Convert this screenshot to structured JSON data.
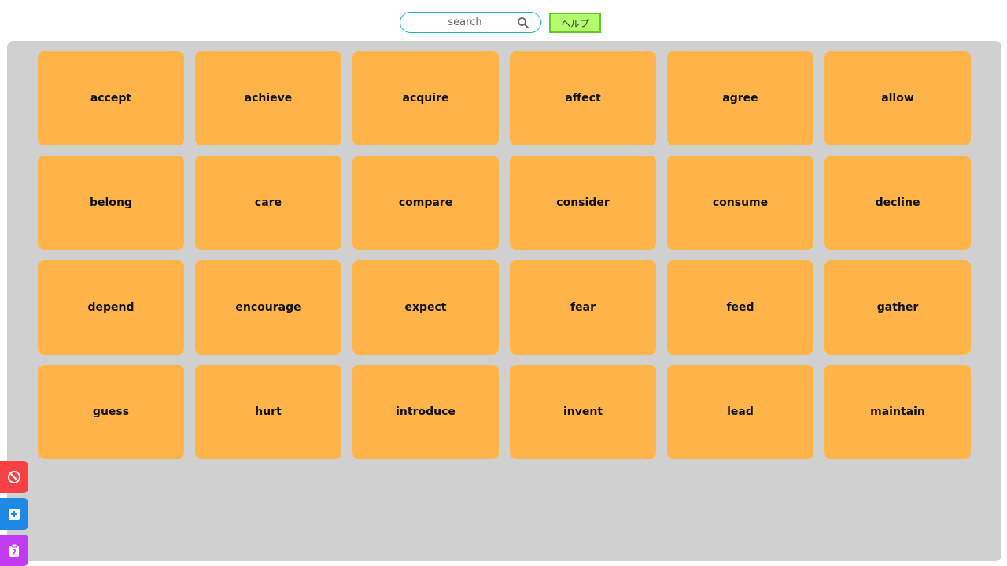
{
  "search": {
    "placeholder": "search",
    "icon": "search-icon"
  },
  "help_button": {
    "label": "ヘルプ",
    "color": "#b4fb6e"
  },
  "colors": {
    "board": "#d0d0d0",
    "card": "#ffb44a",
    "accent": "#1fb3c4"
  },
  "cards": [
    "accept",
    "achieve",
    "acquire",
    "affect",
    "agree",
    "allow",
    "belong",
    "care",
    "compare",
    "consider",
    "consume",
    "decline",
    "depend",
    "encourage",
    "expect",
    "fear",
    "feed",
    "gather",
    "guess",
    "hurt",
    "introduce",
    "invent",
    "lead",
    "maintain"
  ],
  "side_buttons": [
    {
      "icon": "block-icon",
      "color": "#f94144"
    },
    {
      "icon": "add-box-icon",
      "color": "#1e88e5"
    },
    {
      "icon": "clipboard-question-icon",
      "color": "#c13cf0"
    }
  ]
}
